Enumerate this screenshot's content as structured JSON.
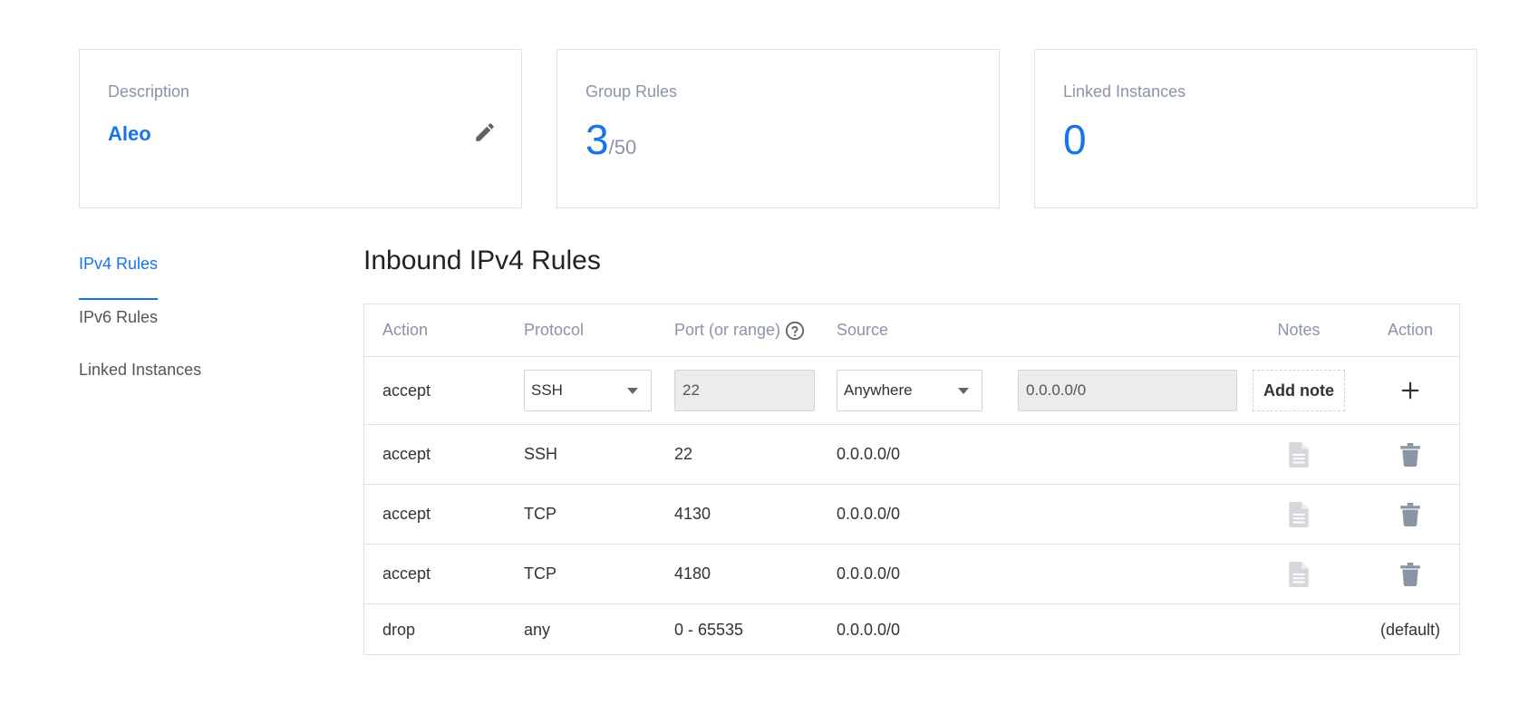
{
  "cards": {
    "description": {
      "label": "Description",
      "value": "Aleo"
    },
    "group_rules": {
      "label": "Group Rules",
      "count": "3",
      "limit": "/50"
    },
    "linked_instances": {
      "label": "Linked Instances",
      "count": "0"
    }
  },
  "side_nav": {
    "items": [
      {
        "label": "IPv4 Rules",
        "active": true
      },
      {
        "label": "IPv6 Rules",
        "active": false
      },
      {
        "label": "Linked Instances",
        "active": false
      }
    ]
  },
  "section_title": "Inbound IPv4 Rules",
  "table": {
    "headers": {
      "action": "Action",
      "protocol": "Protocol",
      "port": "Port (or range)",
      "source": "Source",
      "notes": "Notes",
      "action2": "Action"
    },
    "new_rule": {
      "action": "accept",
      "protocol": "SSH",
      "port": "22",
      "source": "Anywhere",
      "address": "0.0.0.0/0",
      "add_note_label": "Add note"
    },
    "rows": [
      {
        "action": "accept",
        "protocol": "SSH",
        "port": "22",
        "source": "0.0.0.0/0"
      },
      {
        "action": "accept",
        "protocol": "TCP",
        "port": "4130",
        "source": "0.0.0.0/0"
      },
      {
        "action": "accept",
        "protocol": "TCP",
        "port": "4180",
        "source": "0.0.0.0/0"
      }
    ],
    "default_row": {
      "action": "drop",
      "protocol": "any",
      "port": "0 - 65535",
      "source": "0.0.0.0/0",
      "label": "(default)"
    }
  },
  "colors": {
    "accent": "#1a73e8",
    "muted": "#8a94a6",
    "border": "#dde1e6"
  },
  "icons": {
    "edit": "pencil-icon",
    "help": "question-circle-icon",
    "add": "plus-icon",
    "note": "document-icon",
    "delete": "trash-icon"
  }
}
